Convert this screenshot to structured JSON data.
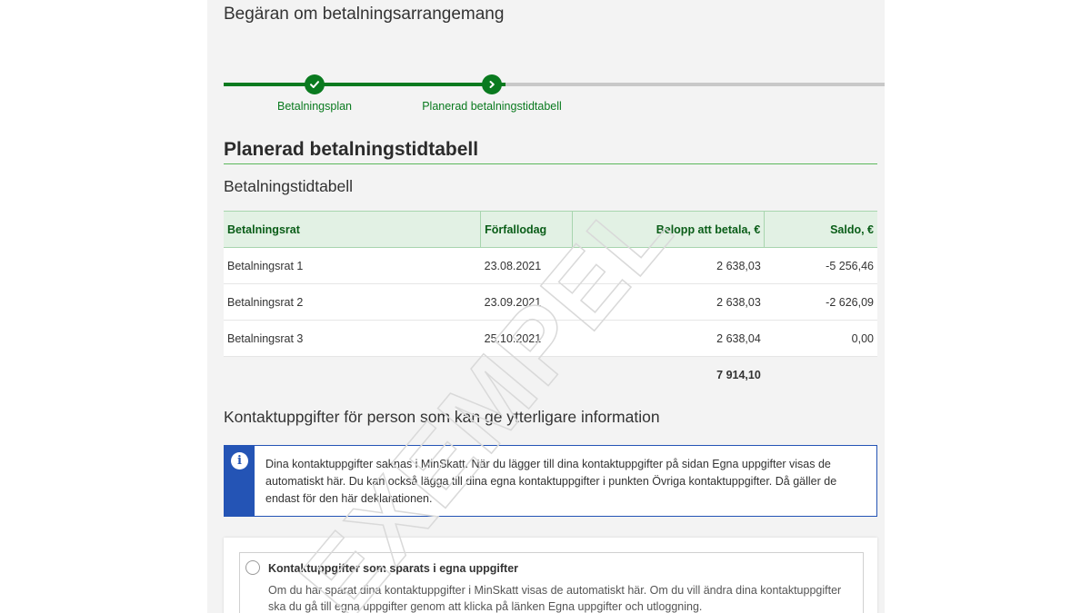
{
  "page": {
    "title": "Begäran om betalningsarrangemang"
  },
  "stepper": {
    "steps": [
      {
        "label": "Betalningsplan",
        "state": "completed",
        "icon": "check-icon"
      },
      {
        "label": "Planerad betalningstidtabell",
        "state": "current",
        "icon": "chevron-right-icon"
      }
    ]
  },
  "schedule": {
    "section_title": "Planerad betalningstidtabell",
    "sub_title": "Betalningstidtabell",
    "headers": {
      "installment": "Betalningsrat",
      "due_date": "Förfallodag",
      "amount": "Belopp att betala, €",
      "balance": "Saldo, €"
    },
    "rows": [
      {
        "installment": "Betalningsrat 1",
        "due_date": "23.08.2021",
        "amount": "2 638,03",
        "balance": "-5 256,46"
      },
      {
        "installment": "Betalningsrat 2",
        "due_date": "23.09.2021",
        "amount": "2 638,03",
        "balance": "-2 626,09"
      },
      {
        "installment": "Betalningsrat 3",
        "due_date": "25.10.2021",
        "amount": "2 638,04",
        "balance": "0,00"
      }
    ],
    "total_amount": "7 914,10"
  },
  "contact": {
    "title": "Kontaktuppgifter för person som kan ge ytterligare information",
    "info_icon": "info-icon",
    "info_text": "Dina kontaktuppgifter saknas i MinSkatt. När du lägger till dina kontaktuppgifter på sidan Egna uppgifter visas de automatiskt här. Du kan också lägga till dina egna kontaktuppgifter i punkten Övriga kontaktuppgifter. Då gäller de endast för den här deklarationen.",
    "option": {
      "title": "Kontaktuppgifter som sparats i egna uppgifter",
      "description": "Om du har sparat dina kontaktuppgifter i MinSkatt visas de automatiskt här. Om du vill ändra dina kontaktuppgifter ska du gå till egna uppgifter genom att klicka på länken Egna uppgifter och utloggning."
    }
  },
  "watermark": {
    "text": "EXEMPEL"
  },
  "colors": {
    "primary_green": "#0a7a1f",
    "header_bg": "#e2f1e4",
    "info_blue": "#2454b5",
    "inactive_line": "#c8c8c8"
  }
}
